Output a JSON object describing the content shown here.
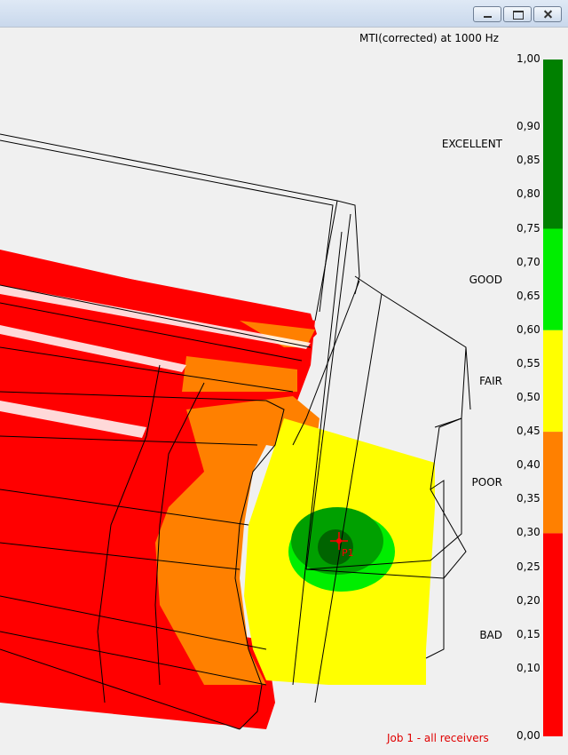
{
  "window": {
    "controls": [
      "minimize",
      "maximize",
      "close"
    ]
  },
  "plot": {
    "title": "MTI(corrected)   at 1000 Hz",
    "footer": "Job 1 - all receivers",
    "receiver_label": "P1",
    "colors": {
      "bad": "#ff0000",
      "poor": "#ff8000",
      "fair": "#ffff00",
      "good": "#00ee00",
      "excellent": "#008000",
      "excellent_dark": "#006400",
      "frame": "#000000"
    }
  },
  "legend": {
    "ticks": [
      "1,00",
      "0,90",
      "0,85",
      "0,80",
      "0,75",
      "0,70",
      "0,65",
      "0,60",
      "0,55",
      "0,50",
      "0,45",
      "0,40",
      "0,35",
      "0,30",
      "0,25",
      "0,20",
      "0,15",
      "0,10",
      "0,00"
    ],
    "bands": [
      {
        "label": "EXCELLENT",
        "from": 0.75,
        "to": 1.0,
        "color": "#008000"
      },
      {
        "label": "GOOD",
        "from": 0.6,
        "to": 0.75,
        "color": "#00ee00"
      },
      {
        "label": "FAIR",
        "from": 0.45,
        "to": 0.6,
        "color": "#ffff00"
      },
      {
        "label": "POOR",
        "from": 0.3,
        "to": 0.45,
        "color": "#ff8000"
      },
      {
        "label": "BAD",
        "from": 0.0,
        "to": 0.3,
        "color": "#ff0000"
      }
    ]
  }
}
